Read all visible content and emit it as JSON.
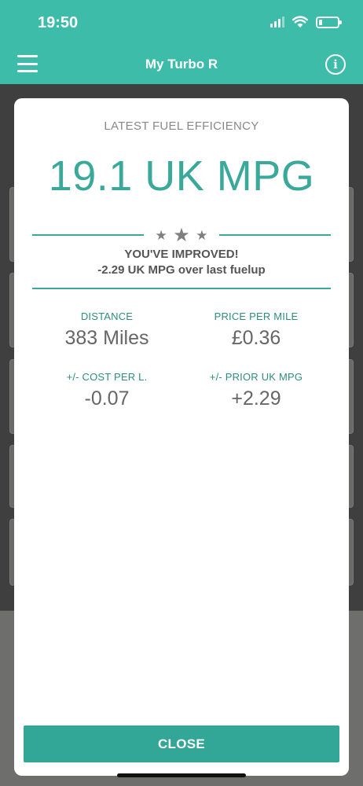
{
  "status_bar": {
    "time": "19:50",
    "battery_level": 0.18
  },
  "header": {
    "title": "My Turbo R",
    "menu_icon": "hamburger-menu-icon",
    "info_icon": "info-icon",
    "info_glyph": "i"
  },
  "modal": {
    "label": "LATEST FUEL EFFICIENCY",
    "value": "19.1 UK MPG",
    "rating_stars": 3,
    "improvement_title": "YOU'VE IMPROVED!",
    "improvement_detail": "-2.29 UK MPG over last fuelup",
    "stats": [
      {
        "label": "DISTANCE",
        "value": "383 Miles"
      },
      {
        "label": "PRICE PER MILE",
        "value": "£0.36"
      },
      {
        "label": "+/- COST PER L.",
        "value": "-0.07"
      },
      {
        "label": "+/- PRIOR UK MPG",
        "value": "+2.29"
      }
    ],
    "close_label": "CLOSE"
  },
  "colors": {
    "accent": "#3dbcaa",
    "button": "#33a797",
    "value_text": "#3aa99a"
  }
}
